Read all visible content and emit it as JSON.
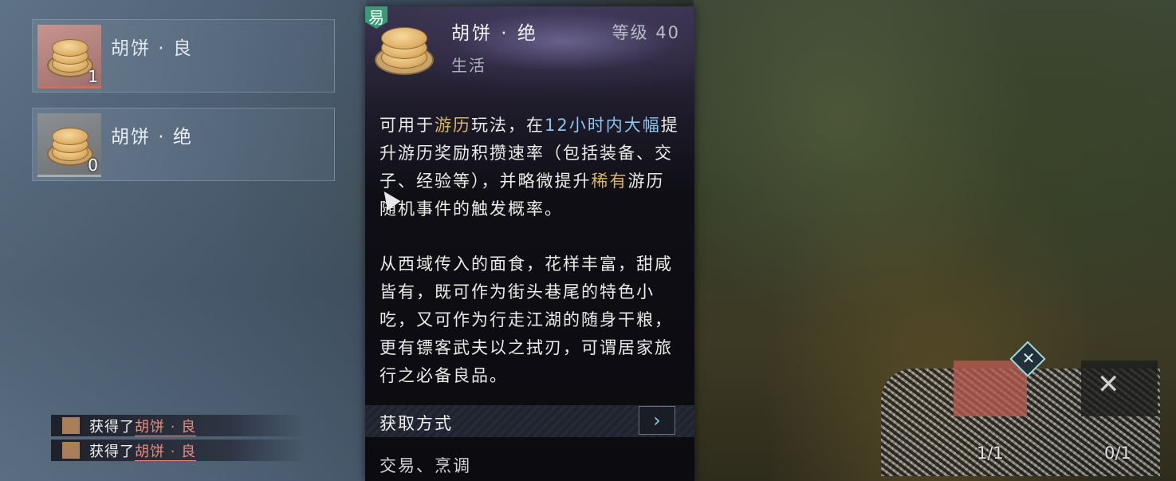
{
  "inventory": {
    "items": [
      {
        "name": "胡饼 · 良",
        "count": "1",
        "quality": "rare"
      },
      {
        "name": "胡饼 · 绝",
        "count": "0",
        "quality": "plain"
      }
    ]
  },
  "tooltip": {
    "trade_badge": "易",
    "name": "胡饼 · 绝",
    "level": "等级 40",
    "category": "生活",
    "desc1": {
      "p1": "可用于",
      "hl1": "游历",
      "p2": "玩法，在",
      "hl2": "12小时内",
      "hl3": "大幅",
      "p3": "提升游历奖励积攒速率（包括装备、交子、经验等），并略微提升",
      "hl4": "稀有",
      "p4": "游历随机事件的触发概率。"
    },
    "desc2": "从西域传入的面食，花样丰富，甜咸皆有，既可作为街头巷尾的特色小吃，又可作为行走江湖的随身干粮，更有镖客武夫以之拭刃，可谓居家旅行之必备良品。",
    "source_label": "获取方式",
    "source_value": "交易、烹调"
  },
  "notifications": [
    {
      "prefix": "获得了",
      "item": "胡饼 · 良"
    },
    {
      "prefix": "获得了",
      "item": "胡饼 · 良"
    }
  ],
  "hud": {
    "slot1_count": "1/1",
    "slot2_count": "0/1"
  },
  "colors": {
    "accent_gold": "#d8b46a",
    "accent_blue": "#8ec4ee",
    "loot_item": "#e98a7c",
    "trade_badge": "#3a9a78"
  }
}
